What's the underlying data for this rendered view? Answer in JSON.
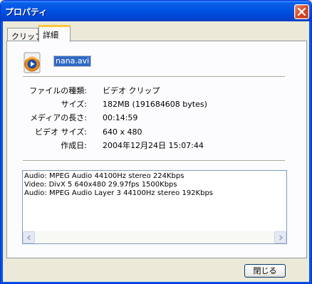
{
  "window": {
    "title": "プロパティ"
  },
  "tabs": [
    {
      "label": "クリップ",
      "active": false
    },
    {
      "label": "詳細",
      "active": true
    }
  ],
  "file": {
    "name": "nana.avi",
    "icon": "media-player-file-icon"
  },
  "properties": [
    {
      "label": "ファイルの種類:",
      "value": "ビデオ クリップ"
    },
    {
      "label": "サイズ:",
      "value": "182MB (191684608 bytes)"
    },
    {
      "label": "メディアの長さ:",
      "value": "00:14:59"
    },
    {
      "label": "ビデオ サイズ:",
      "value": "640 x 480"
    },
    {
      "label": "作成日:",
      "value": "2004年12月24日 15:07:44"
    }
  ],
  "codec_info": [
    "Audio: MPEG Audio 44100Hz stereo 224Kbps",
    "Video: DivX 5 640x480 29.97fps 1500Kbps",
    "Audio: MPEG Audio Layer 3 44100Hz stereo 192Kbps"
  ],
  "buttons": {
    "close_label": "閉じる"
  },
  "colors": {
    "titlebar": "#0054e3",
    "tab_highlight": "#ffc83c",
    "selection": "#316ac5"
  }
}
